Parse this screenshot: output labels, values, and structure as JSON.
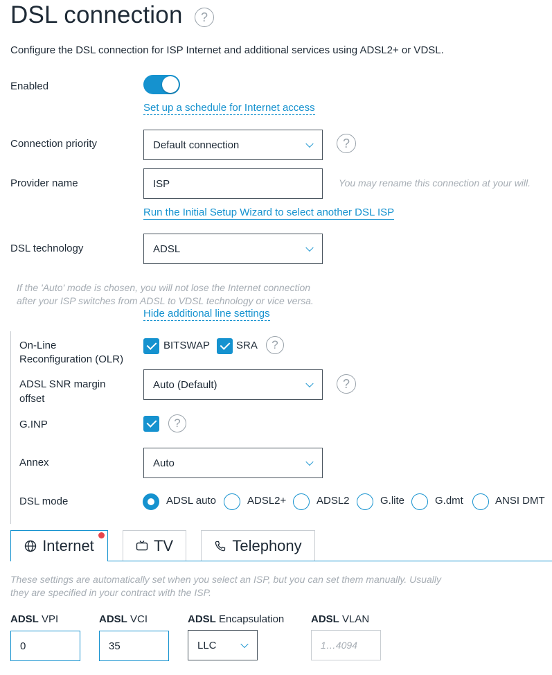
{
  "page": {
    "title": "DSL connection",
    "intro": "Configure the DSL connection for ISP Internet and additional services using ADSL2+ or VDSL.",
    "help_glyph": "?"
  },
  "enabled": {
    "label": "Enabled",
    "state": true
  },
  "schedule_link": "Set up a schedule for Internet access",
  "priority": {
    "label": "Connection priority",
    "value": "Default connection"
  },
  "provider": {
    "label": "Provider name",
    "value": "ISP",
    "hint": "You may rename this connection at your will.",
    "wizard_link": "Run the Initial Setup Wizard to select another DSL ISP"
  },
  "technology": {
    "label": "DSL technology",
    "value": "ADSL",
    "note_line1": "If the 'Auto' mode is chosen, you will not lose the Internet connection",
    "note_line2": "after your ISP switches from ADSL to VDSL technology or vice versa.",
    "hide_link": "Hide additional line settings"
  },
  "olr": {
    "label_line1": "On-Line",
    "label_line2": "Reconfiguration (OLR)",
    "options": [
      {
        "label": "BITSWAP",
        "checked": true
      },
      {
        "label": "SRA",
        "checked": true
      }
    ]
  },
  "snr": {
    "label_line1": "ADSL SNR margin",
    "label_line2": "offset",
    "value": "Auto (Default)"
  },
  "ginp": {
    "label": "G.INP",
    "checked": true
  },
  "annex": {
    "label": "Annex",
    "value": "Auto"
  },
  "dsl_mode": {
    "label": "DSL mode",
    "selected": "ADSL auto",
    "options": [
      "ADSL auto",
      "ADSL2+",
      "ADSL2",
      "G.lite",
      "G.dmt",
      "ANSI DMT"
    ]
  },
  "tabs": [
    {
      "label": "Internet",
      "icon": "globe-icon",
      "active": true,
      "notification": true
    },
    {
      "label": "TV",
      "icon": "tv-icon",
      "active": false
    },
    {
      "label": "Telephony",
      "icon": "phone-icon",
      "active": false
    }
  ],
  "internet": {
    "note_line1": "These settings are automatically set when you select an ISP, but you can set them manually. Usually",
    "note_line2": "they are specified in your contract with the ISP.",
    "fields": {
      "vpi": {
        "prefix": "ADSL",
        "label": "VPI",
        "value": "0"
      },
      "vci": {
        "prefix": "ADSL",
        "label": "VCI",
        "value": "35"
      },
      "encapsulation": {
        "prefix": "ADSL",
        "label": "Encapsulation",
        "value": "LLC"
      },
      "vlan": {
        "prefix": "ADSL",
        "label": "VLAN",
        "placeholder": "1…4094"
      }
    }
  },
  "colors": {
    "accent": "#1592cf",
    "text": "#1e2a36",
    "muted": "#a6adb4",
    "notification": "#e8454c"
  }
}
